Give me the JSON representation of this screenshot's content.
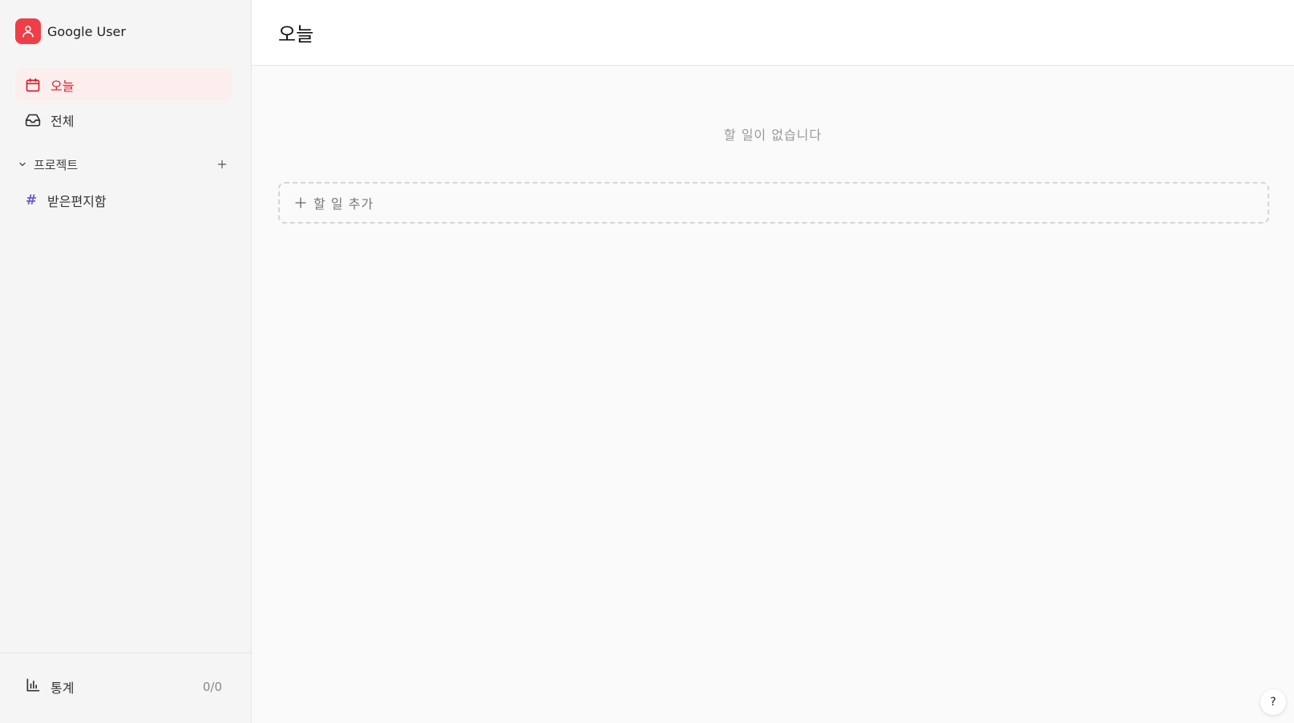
{
  "user": {
    "name": "Google User",
    "avatar_color": "#ef3e48"
  },
  "sidebar": {
    "nav": [
      {
        "label": "오늘",
        "icon": "calendar-icon",
        "active": true
      },
      {
        "label": "전체",
        "icon": "inbox-icon",
        "active": false
      }
    ],
    "projects": {
      "header": "프로젝트",
      "items": [
        {
          "label": "받은편지함",
          "icon": "hash-icon",
          "color": "#6b5bd6"
        }
      ]
    },
    "footer": {
      "stats_label": "통계",
      "stats_count": "0/0",
      "icon": "bar-chart-icon"
    }
  },
  "main": {
    "title": "오늘",
    "empty_text": "할 일이 없습니다",
    "add_task_label": "할 일 추가"
  },
  "help": {
    "label": "?"
  },
  "colors": {
    "accent": "#d91e2a",
    "active_bg": "#fdeeee"
  }
}
